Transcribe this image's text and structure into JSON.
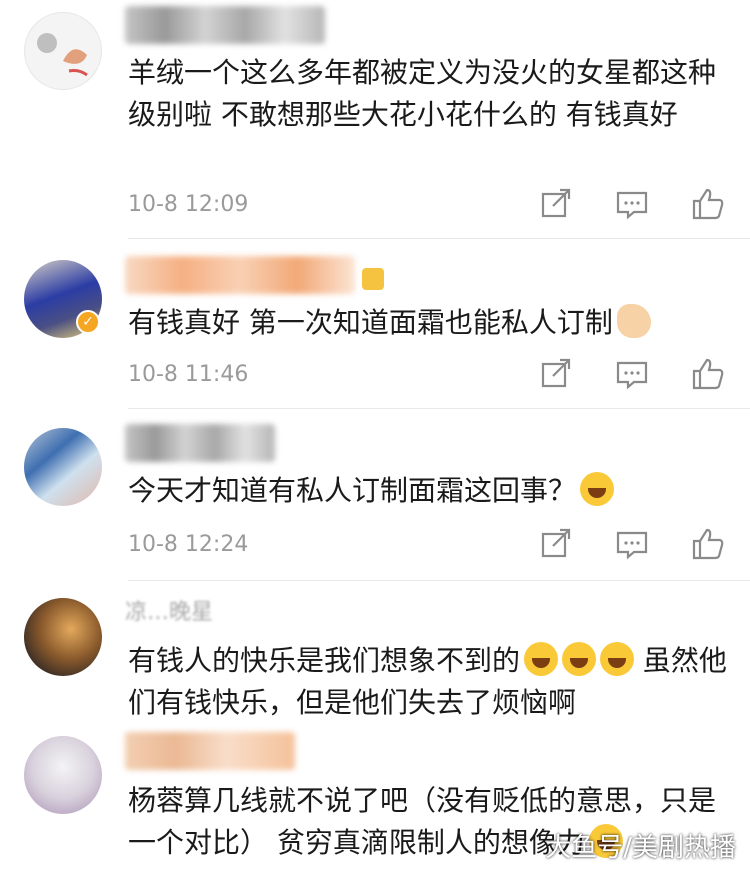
{
  "comments": [
    {
      "text": "羊绒一个这么多年都被定义为没火的女星都这种级别啦 不敢想那些大花小花什么的 有钱真好",
      "time": "10-8 12:09"
    },
    {
      "text": "有钱真好 第一次知道面霜也能私人订制",
      "emoji": "hand-emoji",
      "time": "10-8 11:46"
    },
    {
      "text": "今天才知道有私人订制面霜这回事？",
      "emoji": "laughing-crying-emoji",
      "time": "10-8 12:24"
    },
    {
      "username": "凉…晚星",
      "text_a": "有钱人的快乐是我们想象不到的",
      "text_b": " 虽然他们有钱快乐，但是他们失去了烦恼啊",
      "emoji": "laughing-crying-emoji"
    },
    {
      "text": "杨蓉算几线就不说了吧（没有贬低的意思，只是一个对比） 贫穷真滴限制人的想像力"
    }
  ],
  "watermark": "大鱼号/美剧热播",
  "icons": {
    "share": "share-icon",
    "comment": "comment-icon",
    "like": "thumbs-up-icon"
  },
  "colors": {
    "text": "#1a1a1a",
    "time": "#9a9a9a",
    "icon": "#8a8a8a",
    "vip_badge": "#f5a623",
    "emoji": "#f9c938"
  }
}
